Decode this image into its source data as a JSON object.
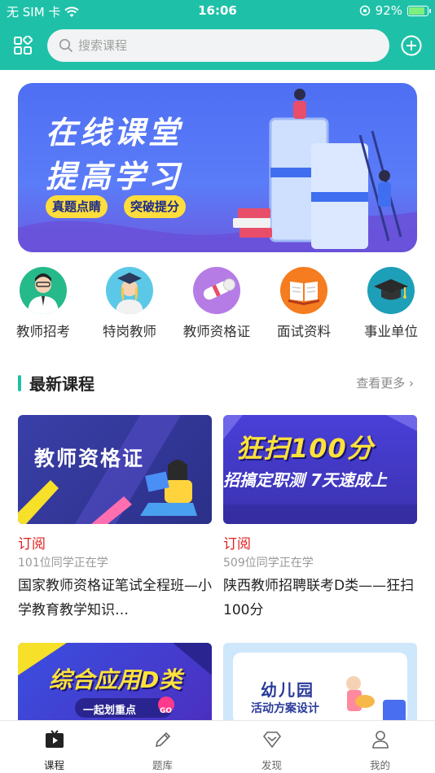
{
  "status_bar": {
    "carrier": "无 SIM 卡",
    "time": "16:06",
    "battery": "92%",
    "battery_level": 0.92
  },
  "search": {
    "placeholder": "搜索课程"
  },
  "banner": {
    "line1": "在线课堂",
    "line2": "提高学习",
    "tag1": "真题点睛",
    "tag2": "突破提分"
  },
  "categories": [
    {
      "label": "教师招考",
      "icon": "teacher-avatar-icon",
      "color": "#26b98a"
    },
    {
      "label": "特岗教师",
      "icon": "graduate-avatar-icon",
      "color": "#5cc8e8"
    },
    {
      "label": "教师资格证",
      "icon": "diploma-scroll-icon",
      "color": "#b57ce6"
    },
    {
      "label": "面试资料",
      "icon": "open-book-icon",
      "color": "#f57c1f"
    },
    {
      "label": "事业单位",
      "icon": "mortarboard-icon",
      "color": "#1e9fb8"
    }
  ],
  "section": {
    "title": "最新课程",
    "more": "查看更多 ›"
  },
  "courses": [
    {
      "thumb_title": "教师资格证",
      "tag": "订阅",
      "learners": "101位同学正在学",
      "title": "国家教师资格证笔试全程班—小学教育教学知识…"
    },
    {
      "thumb_title": "狂扫100分",
      "thumb_subtitle": "招搞定职测 7天速成上",
      "tag": "订阅",
      "learners": "509位同学正在学",
      "title": "陕西教师招聘联考D类——狂扫100分"
    },
    {
      "thumb_title": "综合应用D类",
      "thumb_subtitle": "一起划重点",
      "thumb_badge": "GO"
    },
    {
      "thumb_title": "幼儿园",
      "thumb_subtitle": "活动方案设计"
    }
  ],
  "tabbar": {
    "tabs": [
      {
        "label": "课程",
        "icon": "tv-play-icon",
        "active": true
      },
      {
        "label": "题库",
        "icon": "pencil-icon",
        "active": false
      },
      {
        "label": "发现",
        "icon": "diamond-icon",
        "active": false
      },
      {
        "label": "我的",
        "icon": "person-icon",
        "active": false
      }
    ]
  },
  "colors": {
    "brand": "#1ec1a8",
    "subscribe": "#e02020",
    "banner": "#5577f5"
  }
}
